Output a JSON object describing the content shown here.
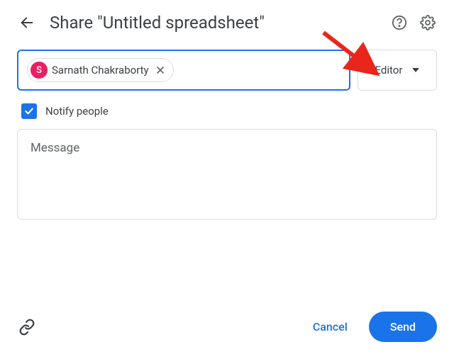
{
  "header": {
    "title": "Share \"Untitled spreadsheet\""
  },
  "people": {
    "chip": {
      "initial": "S",
      "name": "Sarnath Chakraborty"
    }
  },
  "role": {
    "selected": "Editor"
  },
  "notify": {
    "label": "Notify people",
    "checked": true
  },
  "message": {
    "placeholder": "Message"
  },
  "footer": {
    "cancel": "Cancel",
    "send": "Send"
  }
}
